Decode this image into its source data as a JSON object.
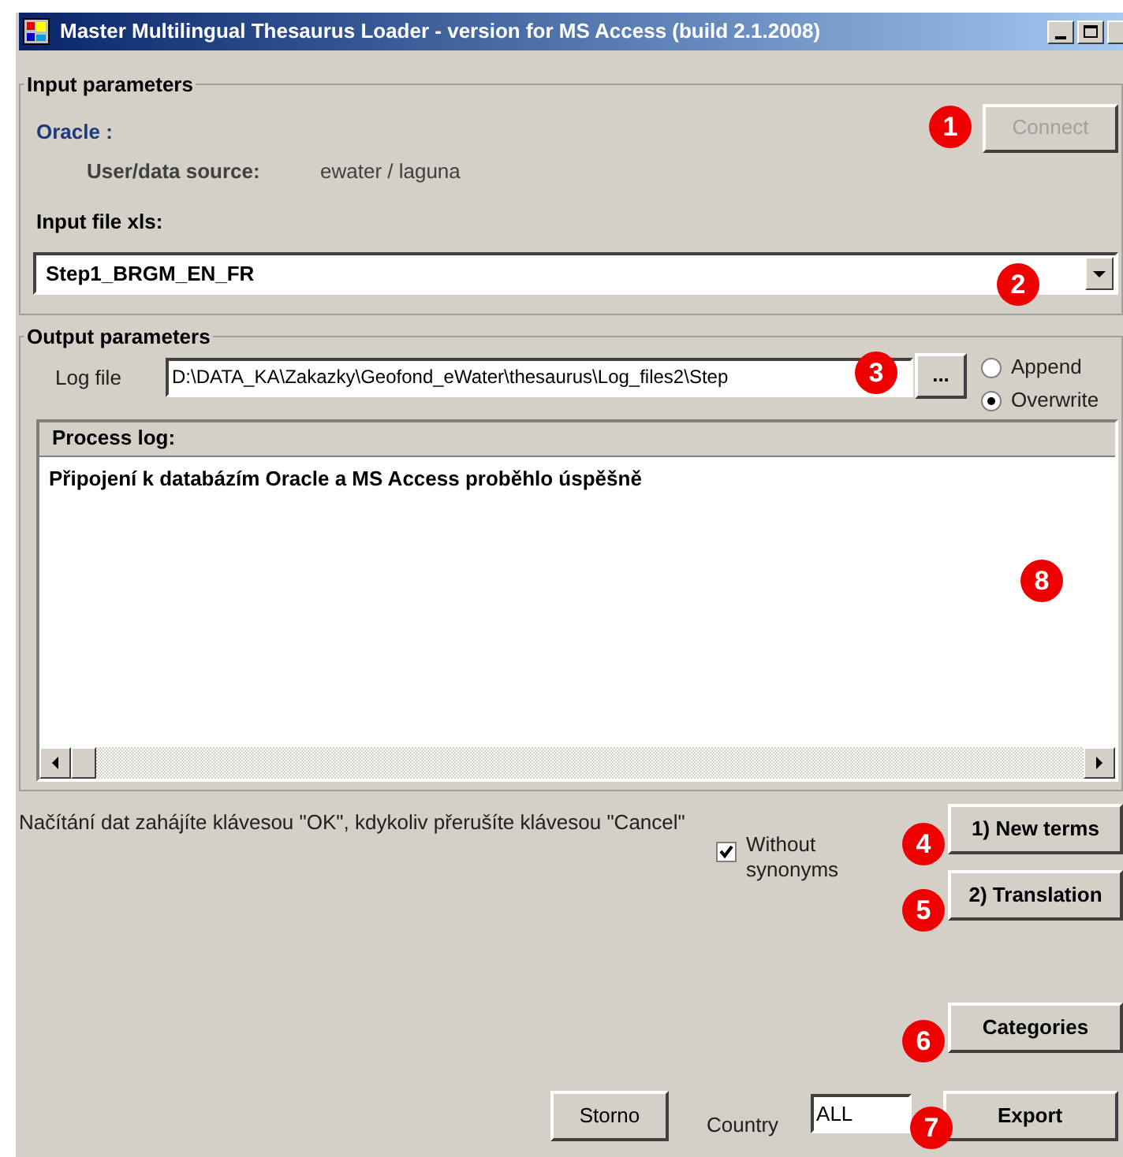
{
  "window": {
    "title": "Master Multilingual Thesaurus Loader - version for MS Access (build 2.1.2008)"
  },
  "input_parameters": {
    "title": "Input parameters",
    "source_label": "Oracle :",
    "user_label": "User/data source:",
    "user_value": "ewater / laguna",
    "connect_button": {
      "label": "Connect",
      "disabled": true
    },
    "file_label": "Input file xls:",
    "file_value": "Step1_BRGM_EN_FR"
  },
  "output_parameters": {
    "title": "Output parameters",
    "log_label": "Log file",
    "log_value": "D:\\DATA_KA\\Zakazky\\Geofond_eWater\\thesaurus\\Log_files2\\Step",
    "browse_button": "...",
    "modes": [
      {
        "label": "Append",
        "selected": false
      },
      {
        "label": "Overwrite",
        "selected": true
      }
    ],
    "process_log": {
      "title": "Process log:",
      "lines": [
        "Připojení k databázím Oracle a MS Access proběhlo úspěšně"
      ]
    }
  },
  "footer": {
    "hint": "Načítání dat zahájíte klávesou \"OK\", kdykoliv přerušíte klávesou \"Cancel\"",
    "synonyms_checkbox": {
      "label": "Without synonyms",
      "checked": true
    },
    "new_terms_button": "1) New terms",
    "translation_button": "2) Translation",
    "categories_button": "Categories",
    "storno_button": "Storno",
    "country_label": "Country",
    "country_value": "ALL",
    "export_button": "Export"
  },
  "annotations": [
    "1",
    "2",
    "3",
    "4",
    "5",
    "6",
    "7",
    "8"
  ]
}
